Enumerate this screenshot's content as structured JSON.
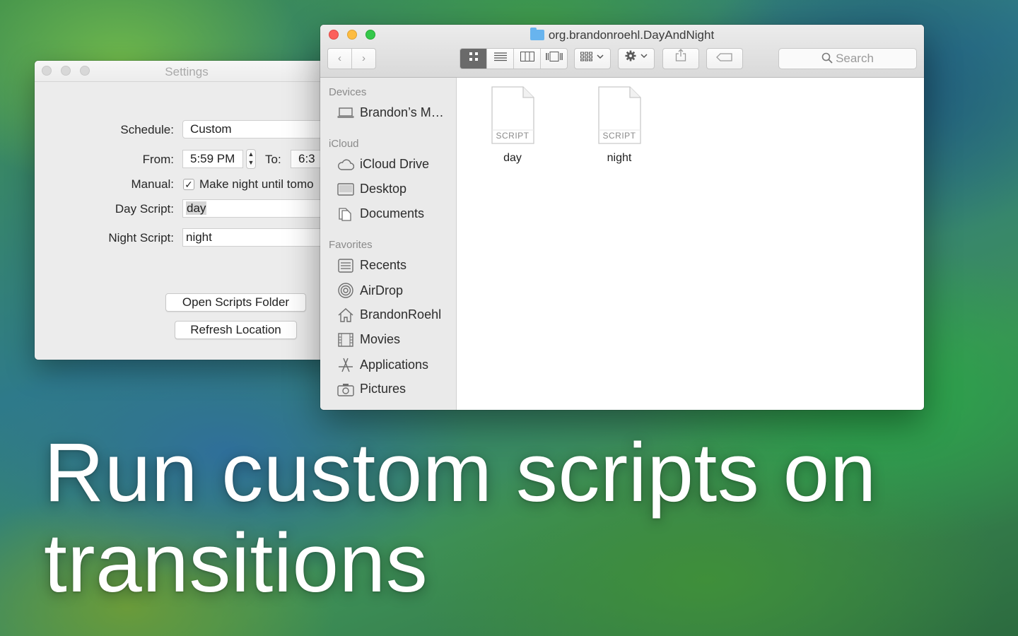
{
  "settings": {
    "title": "Settings",
    "schedule_label": "Schedule:",
    "schedule_value": "Custom",
    "from_label": "From:",
    "from_value": "5:59 PM",
    "to_label": "To:",
    "to_value": "6:3",
    "manual_label": "Manual:",
    "manual_checked": true,
    "manual_text": "Make night until tomo",
    "day_script_label": "Day Script:",
    "day_script_value": "day",
    "night_script_label": "Night Script:",
    "night_script_value": "night",
    "open_scripts_button": "Open Scripts Folder",
    "refresh_location_button": "Refresh Location"
  },
  "finder": {
    "title": "org.brandonroehl.DayAndNight",
    "search_placeholder": "Search",
    "sidebar": {
      "sections": [
        {
          "header": "Devices",
          "items": [
            {
              "label": "Brandon’s M…",
              "icon": "laptop-icon"
            }
          ]
        },
        {
          "header": "iCloud",
          "items": [
            {
              "label": "iCloud Drive",
              "icon": "cloud-icon"
            },
            {
              "label": "Desktop",
              "icon": "desktop-icon"
            },
            {
              "label": "Documents",
              "icon": "documents-icon"
            }
          ]
        },
        {
          "header": "Favorites",
          "items": [
            {
              "label": "Recents",
              "icon": "recents-icon"
            },
            {
              "label": "AirDrop",
              "icon": "airdrop-icon"
            },
            {
              "label": "BrandonRoehl",
              "icon": "home-icon"
            },
            {
              "label": "Movies",
              "icon": "movies-icon"
            },
            {
              "label": "Applications",
              "icon": "applications-icon"
            },
            {
              "label": "Pictures",
              "icon": "pictures-icon"
            }
          ]
        }
      ]
    },
    "files": [
      {
        "name": "day",
        "kind": "SCRIPT"
      },
      {
        "name": "night",
        "kind": "SCRIPT"
      }
    ]
  },
  "headline": {
    "line1": "Run custom scripts on",
    "line2": "transitions"
  },
  "colors": {
    "close": "#fc605b",
    "minimize": "#fdbc40",
    "zoom": "#34c84a",
    "folder": "#68b4ee"
  }
}
